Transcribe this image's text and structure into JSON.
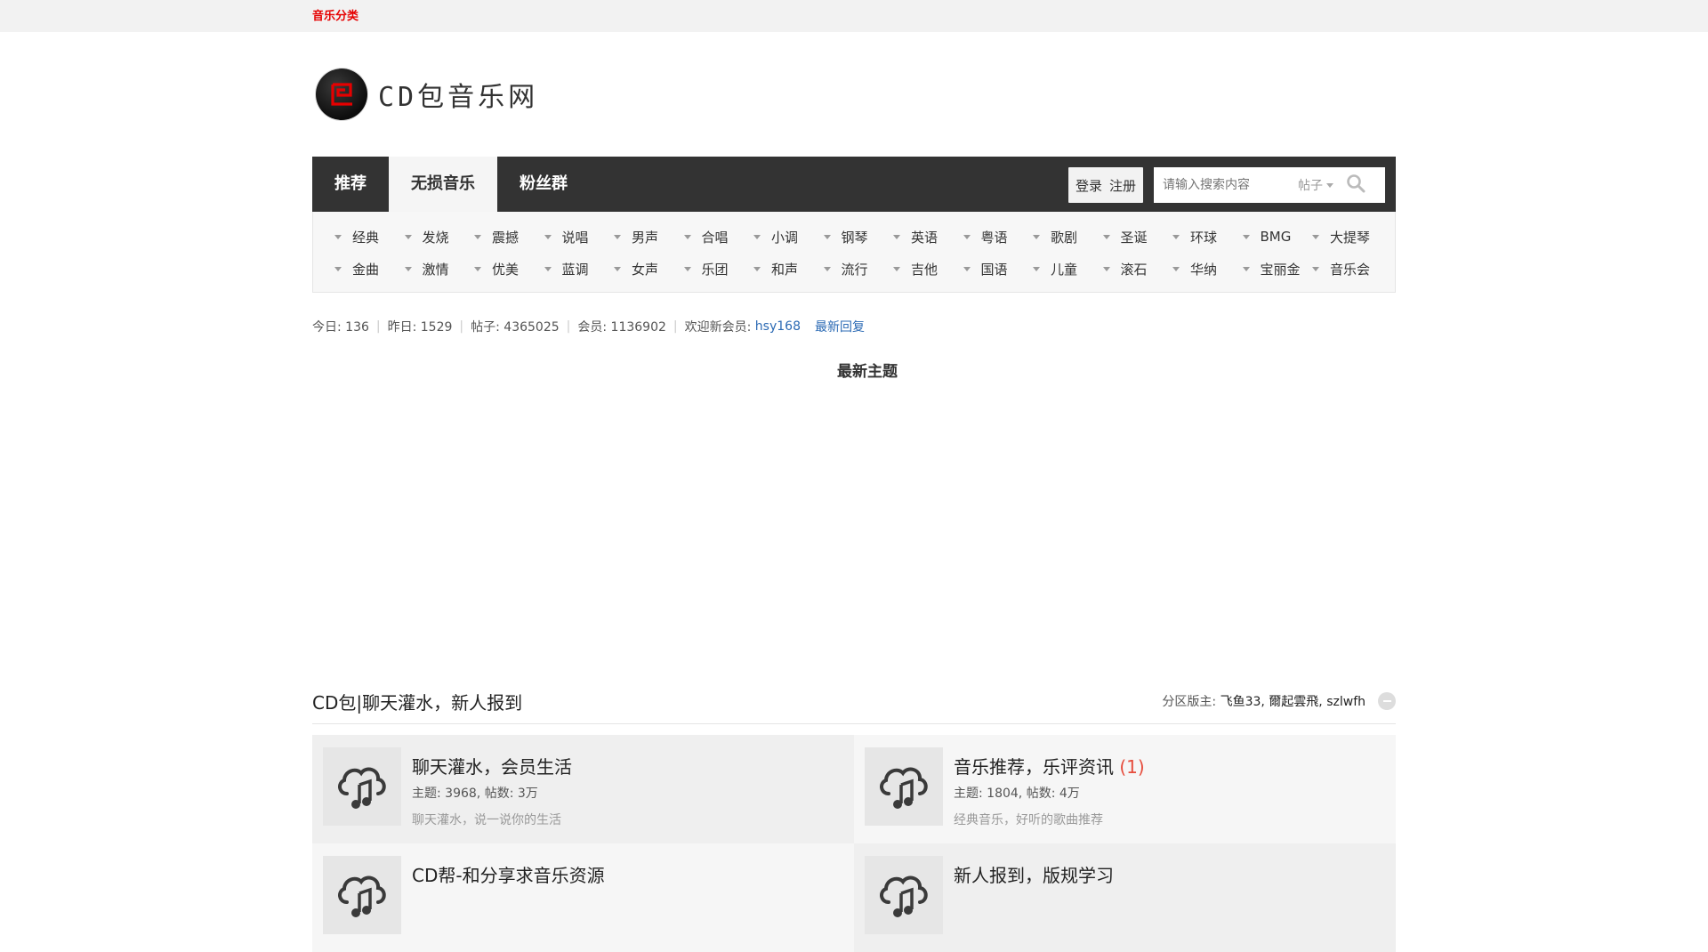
{
  "topbar": {
    "link": "音乐分类"
  },
  "logo": {
    "text": "CD包音乐网"
  },
  "nav": {
    "items": [
      "推荐",
      "无损音乐",
      "粉丝群"
    ],
    "active": 1
  },
  "auth": {
    "login": "登录",
    "register": "注册"
  },
  "search": {
    "placeholder": "请输入搜索内容",
    "type": "帖子"
  },
  "categories": {
    "row1": [
      "经典",
      "发烧",
      "震撼",
      "说唱",
      "男声",
      "合唱",
      "小调",
      "钢琴",
      "英语",
      "粤语",
      "歌剧",
      "圣诞",
      "环球",
      "BMG",
      "大提琴"
    ],
    "row2": [
      "金曲",
      "激情",
      "优美",
      "蓝调",
      "女声",
      "乐团",
      "和声",
      "流行",
      "吉他",
      "国语",
      "儿童",
      "滚石",
      "华纳",
      "宝丽金",
      "音乐会"
    ]
  },
  "stats": {
    "today": "今日: 136",
    "yesterday": "昨日: 1529",
    "posts": "帖子: 4365025",
    "members": "会员: 1136902",
    "welcome_label": "欢迎新会员: ",
    "new_member": "hsy168",
    "latest_reply": "最新回复"
  },
  "newest_title": "最新主题",
  "section": {
    "title": "CD包|聊天灌水，新人报到",
    "moderators_label": "分区版主: ",
    "moderators": "飞鱼33, 爾起雲飛, szlwfh"
  },
  "forums": [
    {
      "title": "聊天灌水，会员生活",
      "count": "",
      "meta": "主题: 3968, 帖数: 3万",
      "desc": "聊天灌水，说一说你的生活"
    },
    {
      "title": "音乐推荐，乐评资讯",
      "count": "(1)",
      "meta": "主题: 1804, 帖数: 4万",
      "desc": "经典音乐，好听的歌曲推荐"
    },
    {
      "title": "CD帮-和分享求音乐资源",
      "count": "",
      "meta": "",
      "desc": ""
    },
    {
      "title": "新人报到，版规学习",
      "count": "",
      "meta": "",
      "desc": ""
    }
  ],
  "colors": {
    "accent_red": "#e60000",
    "nav_bg": "#333333",
    "link_blue": "#2b6ab4",
    "count_red": "#e64c3c"
  }
}
